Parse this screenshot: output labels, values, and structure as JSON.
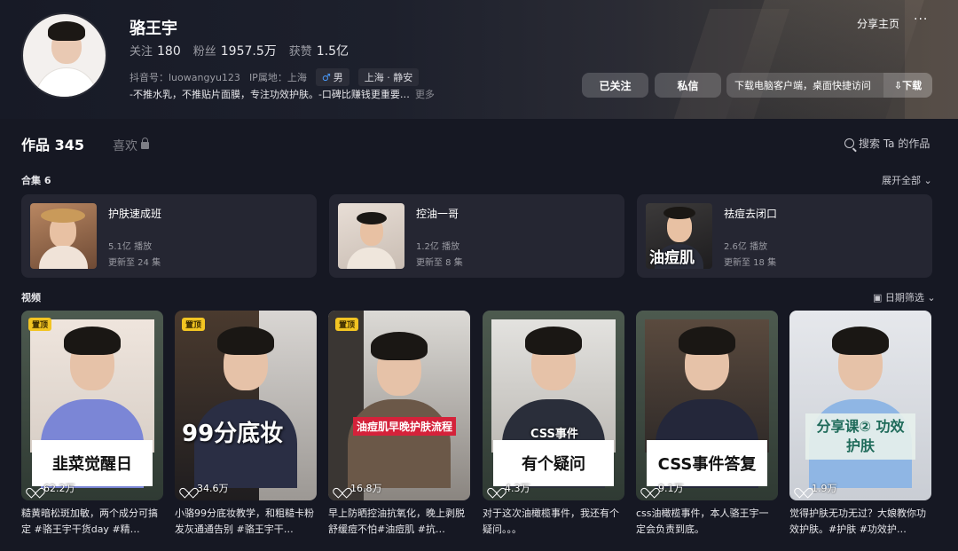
{
  "profile": {
    "name": "骆王宇",
    "following_label": "关注",
    "following": "180",
    "fans_label": "粉丝",
    "fans": "1957.5万",
    "likes_label": "获赞",
    "likes": "1.5亿",
    "account_id": "抖音号：luowangyu123",
    "ip": "IP属地：上海",
    "gender_icon": "male-icon",
    "gender_tag": "男",
    "location_tag": "上海 · 静安",
    "bio": "-不推水乳，不推贴片面膜，专注功效护肤。-口碑比赚钱更重要…",
    "bio_more": "更多"
  },
  "header": {
    "share_label": "分享主页",
    "more_label": "···",
    "followed_button": "已关注",
    "message_button": "私信",
    "download_text": "下载电脑客户端，桌面快捷访问",
    "download_button": "⇩下载"
  },
  "tabs": {
    "works": "作品 345",
    "likes": "喜欢"
  },
  "search": {
    "label": "搜索 Ta 的作品"
  },
  "collections": {
    "title": "合集 6",
    "expand": "展开全部 ⌄",
    "items": [
      {
        "title": "护肤速成班",
        "plays": "5.1亿 播放",
        "update": "更新至 24 集",
        "thumb_text": ""
      },
      {
        "title": "控油一哥",
        "plays": "1.2亿 播放",
        "update": "更新至 8 集",
        "thumb_text": ""
      },
      {
        "title": "祛痘去闭口",
        "plays": "2.6亿 播放",
        "update": "更新至 18 集",
        "thumb_text": "油痘肌"
      }
    ]
  },
  "videos": {
    "title": "视频",
    "filter": "▣ 日期筛选 ⌄",
    "pinned_label": "置顶",
    "items": [
      {
        "caption": "韭菜觉醒日",
        "likes": "62.2万",
        "desc": "糙黄暗松斑加敏，两个成分可搞定 #骆王宇干货day #精…",
        "pinned": true
      },
      {
        "caption": "99分底妆",
        "likes": "34.6万",
        "desc": "小骆99分底妆教学，和粗糙卡粉发灰通通告别 #骆王宇干…",
        "pinned": true
      },
      {
        "caption": "油痘肌早晚护肤流程",
        "likes": "16.8万",
        "desc": "早上防晒控油抗氧化，晚上剥脱舒缓痘不怕#油痘肌 #抗…",
        "pinned": true
      },
      {
        "caption": "有个疑问",
        "sub_caption": "CSS事件",
        "likes": "4.3万",
        "desc": "对于这次油橄榄事件，我还有个疑问。。。",
        "pinned": false
      },
      {
        "caption": "CSS事件答复",
        "likes": "9.1万",
        "desc": "css油橄榄事件，本人骆王宇一定会负责到底。",
        "pinned": false
      },
      {
        "caption": "分享课② 功效护肤",
        "likes": "1.9万",
        "desc": "觉得护肤无功无过？大娘教你功效护肤。#护肤 #功效护…",
        "pinned": false
      }
    ]
  },
  "colors": {
    "background": "#161823",
    "card": "#252632",
    "pin": "#f2c422",
    "accent_blue": "#4a9cff"
  }
}
